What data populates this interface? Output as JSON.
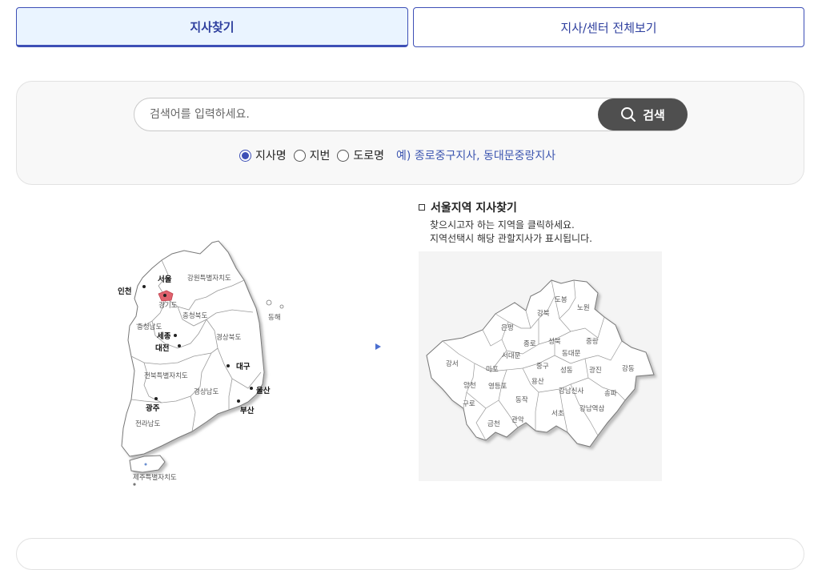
{
  "tabs": {
    "find_branch": "지사찾기",
    "view_all": "지사/센터 전체보기"
  },
  "search": {
    "placeholder": "검색어를 입력하세요.",
    "button_label": "검색",
    "options": [
      "지사명",
      "지번",
      "도로명"
    ],
    "selected": "지사명",
    "example": "예) 종로중구지사, 동대문중랑지사"
  },
  "korea_map": {
    "regions": [
      "강원특별자치도",
      "경기도",
      "충청북도",
      "충청남도",
      "경상북도",
      "전북특별자치도",
      "경상남도",
      "전라남도",
      "제주특별자치도"
    ],
    "cities": [
      "서울",
      "인천",
      "세종",
      "대전",
      "대구",
      "울산",
      "광주",
      "부산"
    ],
    "sea_label": "동해",
    "highlight": "서울",
    "highlight_color": "#e0626e"
  },
  "seoul_panel": {
    "title": "서울지역 지사찾기",
    "desc_line1": "찾으시고자 하는 지역을 클릭하세요.",
    "desc_line2": "지역선택시 해당 관할지사가 표시됩니다.",
    "districts": [
      "도봉",
      "노원",
      "강북",
      "은평",
      "성북",
      "중랑",
      "종로",
      "동대문",
      "서대문",
      "강서",
      "마포",
      "중구",
      "성동",
      "광진",
      "강동",
      "용산",
      "양천",
      "영등포",
      "강남신사",
      "송파",
      "구로",
      "동작",
      "서초",
      "강남역삼",
      "금천",
      "관악"
    ]
  },
  "colors": {
    "accent": "#3d4fb6",
    "search_button": "#4f4f4f"
  }
}
